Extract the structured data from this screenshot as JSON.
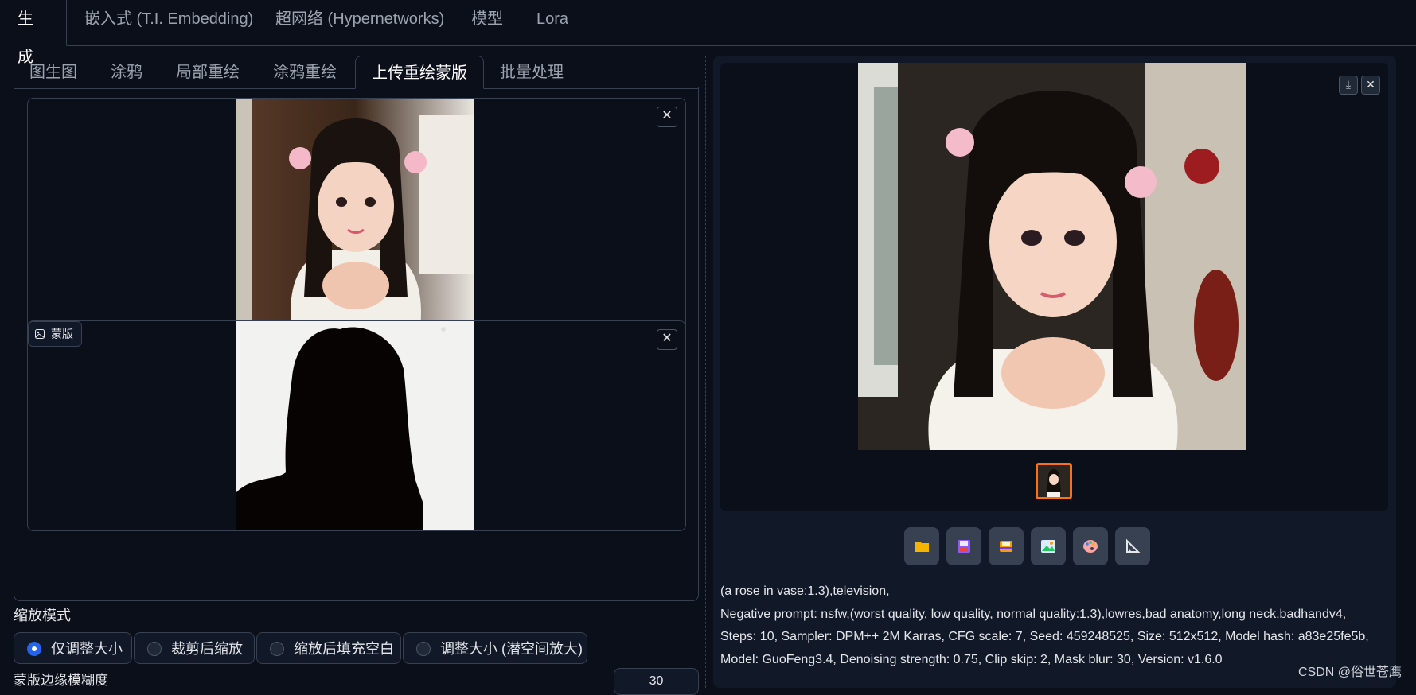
{
  "top_tabs": [
    {
      "label": "生成",
      "active": true
    },
    {
      "label": "嵌入式 (T.I. Embedding)",
      "active": false
    },
    {
      "label": "超网络 (Hypernetworks)",
      "active": false
    },
    {
      "label": "模型",
      "active": false
    },
    {
      "label": "Lora",
      "active": false
    }
  ],
  "sub_tabs": [
    {
      "label": "图生图",
      "active": false
    },
    {
      "label": "涂鸦",
      "active": false
    },
    {
      "label": "局部重绘",
      "active": false
    },
    {
      "label": "涂鸦重绘",
      "active": false
    },
    {
      "label": "上传重绘蒙版",
      "active": true
    },
    {
      "label": "批量处理",
      "active": false
    }
  ],
  "source_image": {
    "close_icon": "close-icon"
  },
  "mask_image": {
    "label": "蒙版",
    "label_icon": "image-icon",
    "close_icon": "close-icon"
  },
  "resize_mode": {
    "label": "缩放模式",
    "options": [
      "仅调整大小",
      "裁剪后缩放",
      "缩放后填充空白",
      "调整大小 (潜空间放大)"
    ],
    "selected": "仅调整大小"
  },
  "mask_blur": {
    "label": "蒙版边缘模糊度",
    "value": "30"
  },
  "gallery": {
    "download_icon": "download-icon",
    "close_icon": "close-icon"
  },
  "toolbar": [
    {
      "name": "folder-icon",
      "color": "#f5b400"
    },
    {
      "name": "save-icon",
      "color": "#8b5cf6"
    },
    {
      "name": "zip-save-icon",
      "color": "#f59e0b"
    },
    {
      "name": "send-to-img2img-icon",
      "color": "#3b82f6"
    },
    {
      "name": "send-to-inpaint-icon",
      "color": "#f87171"
    },
    {
      "name": "send-to-extras-icon",
      "color": "#e5e7eb"
    }
  ],
  "generation_info": [
    "(a rose in vase:1.3),television,",
    "Negative prompt: nsfw,(worst quality, low quality, normal quality:1.3),lowres,bad anatomy,long neck,badhandv4,",
    "Steps: 10, Sampler: DPM++ 2M Karras, CFG scale: 7, Seed: 459248525, Size: 512x512, Model hash: a83e25fe5b,",
    "Model: GuoFeng3.4, Denoising strength: 0.75, Clip skip: 2, Mask blur: 30, Version: v1.6.0"
  ],
  "watermark": "CSDN @俗世苍鹰"
}
